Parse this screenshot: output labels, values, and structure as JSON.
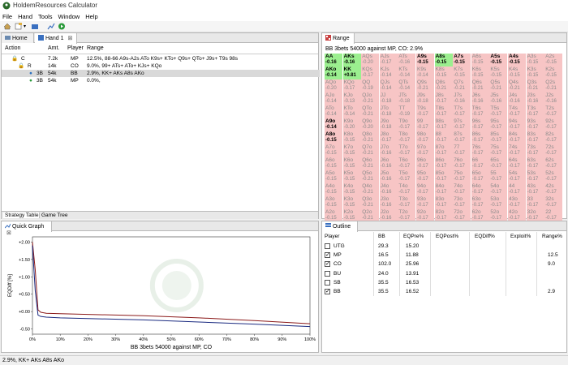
{
  "app": {
    "title": "HoldemResources Calculator"
  },
  "menu": [
    "File",
    "Hand",
    "Tools",
    "Window",
    "Help"
  ],
  "left_tabs": {
    "home": "Home",
    "hand": "Hand 1"
  },
  "table": {
    "headers": [
      "Action",
      "Amt.",
      "Player",
      "Range"
    ],
    "rows": [
      {
        "action": "C",
        "amt": "7.2k",
        "player": "MP",
        "range": "12.5%, 88-66 A9s-A2s ATo K9s+ KTo+ Q9s+ QTo+ J9s+ T9s 98s"
      },
      {
        "action": "R",
        "amt": "14k",
        "player": "CO",
        "range": "9.0%, 99+ ATs+ ATo+ KJs+ KQo"
      },
      {
        "action": "3B",
        "amt": "54k",
        "player": "BB",
        "range": "2.9%, KK+ AKs A8s AKo"
      },
      {
        "action": "3B",
        "amt": "54k",
        "player": "MP",
        "range": "0.0%,"
      }
    ]
  },
  "bottom_tabs": [
    "Strategy Table",
    "Game Tree"
  ],
  "range_panel": {
    "title": "Range",
    "description": "BB 3bets 54000 against MP, CO: 2.9%",
    "cells": [
      [
        "AA",
        "-0.16"
      ],
      [
        "AKs",
        "-0.16"
      ],
      [
        "AQs",
        "-0.20"
      ],
      [
        "AJs",
        "-0.17"
      ],
      [
        "ATs",
        "-0.16"
      ],
      [
        "A9s",
        "-0.15"
      ],
      [
        "A8s",
        "-0.15"
      ],
      [
        "A7s",
        "-0.15"
      ],
      [
        "A6s",
        "-0.15"
      ],
      [
        "A5s",
        "-0.15"
      ],
      [
        "A4s",
        "-0.15"
      ],
      [
        "A3s",
        "-0.15"
      ],
      [
        "A2s",
        "-0.15"
      ],
      [
        "AKo",
        "-0.14"
      ],
      [
        "KK",
        "+0.81"
      ],
      [
        "KQs",
        "-0.17"
      ],
      [
        "KJs",
        "-0.14"
      ],
      [
        "KTs",
        "-0.14"
      ],
      [
        "K9s",
        "-0.14"
      ],
      [
        "K8s",
        "-0.15"
      ],
      [
        "K7s",
        "-0.15"
      ],
      [
        "K6s",
        "-0.15"
      ],
      [
        "K5s",
        "-0.15"
      ],
      [
        "K4s",
        "-0.15"
      ],
      [
        "K3s",
        "-0.15"
      ],
      [
        "K2s",
        "-0.15"
      ],
      [
        "AQo",
        "-0.20"
      ],
      [
        "KQo",
        "-0.17"
      ],
      [
        "QQ",
        "-0.19"
      ],
      [
        "QJs",
        "-0.14"
      ],
      [
        "QTs",
        "-0.14"
      ],
      [
        "Q9s",
        "-0.21"
      ],
      [
        "Q8s",
        "-0.21"
      ],
      [
        "Q7s",
        "-0.21"
      ],
      [
        "Q6s",
        "-0.21"
      ],
      [
        "Q5s",
        "-0.21"
      ],
      [
        "Q4s",
        "-0.21"
      ],
      [
        "Q3s",
        "-0.21"
      ],
      [
        "Q2s",
        "-0.21"
      ],
      [
        "AJo",
        "-0.14"
      ],
      [
        "KJo",
        "-0.13"
      ],
      [
        "QJo",
        "-0.21"
      ],
      [
        "JJ",
        "-0.18"
      ],
      [
        "JTs",
        "-0.18"
      ],
      [
        "J9s",
        "-0.18"
      ],
      [
        "J8s",
        "-0.17"
      ],
      [
        "J7s",
        "-0.16"
      ],
      [
        "J6s",
        "-0.16"
      ],
      [
        "J5s",
        "-0.16"
      ],
      [
        "J4s",
        "-0.16"
      ],
      [
        "J3s",
        "-0.16"
      ],
      [
        "J2s",
        "-0.16"
      ],
      [
        "ATo",
        "-0.14"
      ],
      [
        "KTo",
        "-0.14"
      ],
      [
        "QTo",
        "-0.21"
      ],
      [
        "JTo",
        "-0.18"
      ],
      [
        "TT",
        "-0.19"
      ],
      [
        "T9s",
        "-0.17"
      ],
      [
        "T8s",
        "-0.17"
      ],
      [
        "T7s",
        "-0.17"
      ],
      [
        "T6s",
        "-0.17"
      ],
      [
        "T5s",
        "-0.17"
      ],
      [
        "T4s",
        "-0.17"
      ],
      [
        "T3s",
        "-0.17"
      ],
      [
        "T2s",
        "-0.17"
      ],
      [
        "A9o",
        "-0.14"
      ],
      [
        "K9o",
        "-0.20"
      ],
      [
        "Q9o",
        "-0.20"
      ],
      [
        "J9o",
        "-0.18"
      ],
      [
        "T9o",
        "-0.17"
      ],
      [
        "99",
        "-0.17"
      ],
      [
        "98s",
        "-0.17"
      ],
      [
        "97s",
        "-0.17"
      ],
      [
        "96s",
        "-0.17"
      ],
      [
        "95s",
        "-0.17"
      ],
      [
        "94s",
        "-0.17"
      ],
      [
        "93s",
        "-0.17"
      ],
      [
        "92s",
        "-0.17"
      ],
      [
        "A8o",
        "-0.15"
      ],
      [
        "K8o",
        "-0.15"
      ],
      [
        "Q8o",
        "-0.21"
      ],
      [
        "J8o",
        "-0.17"
      ],
      [
        "T8o",
        "-0.17"
      ],
      [
        "98o",
        "-0.17"
      ],
      [
        "88",
        "-0.17"
      ],
      [
        "87s",
        "-0.17"
      ],
      [
        "86s",
        "-0.17"
      ],
      [
        "85s",
        "-0.17"
      ],
      [
        "84s",
        "-0.17"
      ],
      [
        "83s",
        "-0.17"
      ],
      [
        "82s",
        "-0.17"
      ],
      [
        "A7o",
        "-0.15"
      ],
      [
        "K7o",
        "-0.15"
      ],
      [
        "Q7o",
        "-0.21"
      ],
      [
        "J7o",
        "-0.16"
      ],
      [
        "T7o",
        "-0.17"
      ],
      [
        "97o",
        "-0.17"
      ],
      [
        "87o",
        "-0.17"
      ],
      [
        "77",
        "-0.17"
      ],
      [
        "76s",
        "-0.17"
      ],
      [
        "75s",
        "-0.17"
      ],
      [
        "74s",
        "-0.17"
      ],
      [
        "73s",
        "-0.17"
      ],
      [
        "72s",
        "-0.17"
      ],
      [
        "A6o",
        "-0.15"
      ],
      [
        "K6o",
        "-0.15"
      ],
      [
        "Q6o",
        "-0.21"
      ],
      [
        "J6o",
        "-0.16"
      ],
      [
        "T6o",
        "-0.17"
      ],
      [
        "96o",
        "-0.17"
      ],
      [
        "86o",
        "-0.17"
      ],
      [
        "76o",
        "-0.17"
      ],
      [
        "66",
        "-0.17"
      ],
      [
        "65s",
        "-0.17"
      ],
      [
        "64s",
        "-0.17"
      ],
      [
        "63s",
        "-0.17"
      ],
      [
        "62s",
        "-0.17"
      ],
      [
        "A5o",
        "-0.15"
      ],
      [
        "K5o",
        "-0.15"
      ],
      [
        "Q5o",
        "-0.21"
      ],
      [
        "J5o",
        "-0.16"
      ],
      [
        "T5o",
        "-0.17"
      ],
      [
        "95o",
        "-0.17"
      ],
      [
        "85o",
        "-0.17"
      ],
      [
        "75o",
        "-0.17"
      ],
      [
        "65o",
        "-0.17"
      ],
      [
        "55",
        "-0.17"
      ],
      [
        "54s",
        "-0.17"
      ],
      [
        "53s",
        "-0.17"
      ],
      [
        "52s",
        "-0.17"
      ],
      [
        "A4o",
        "-0.15"
      ],
      [
        "K4o",
        "-0.15"
      ],
      [
        "Q4o",
        "-0.21"
      ],
      [
        "J4o",
        "-0.16"
      ],
      [
        "T4o",
        "-0.17"
      ],
      [
        "94o",
        "-0.17"
      ],
      [
        "84o",
        "-0.17"
      ],
      [
        "74o",
        "-0.17"
      ],
      [
        "64o",
        "-0.17"
      ],
      [
        "54o",
        "-0.17"
      ],
      [
        "44",
        "-0.17"
      ],
      [
        "43s",
        "-0.17"
      ],
      [
        "42s",
        "-0.17"
      ],
      [
        "A3o",
        "-0.15"
      ],
      [
        "K3o",
        "-0.15"
      ],
      [
        "Q3o",
        "-0.21"
      ],
      [
        "J3o",
        "-0.16"
      ],
      [
        "T3o",
        "-0.17"
      ],
      [
        "93o",
        "-0.17"
      ],
      [
        "83o",
        "-0.17"
      ],
      [
        "73o",
        "-0.17"
      ],
      [
        "63o",
        "-0.17"
      ],
      [
        "53o",
        "-0.17"
      ],
      [
        "43o",
        "-0.17"
      ],
      [
        "33",
        "-0.17"
      ],
      [
        "32s",
        "-0.17"
      ],
      [
        "A2o",
        "-0.15"
      ],
      [
        "K2o",
        "-0.15"
      ],
      [
        "Q2o",
        "-0.21"
      ],
      [
        "J2o",
        "-0.16"
      ],
      [
        "T2o",
        "-0.17"
      ],
      [
        "92o",
        "-0.17"
      ],
      [
        "82o",
        "-0.17"
      ],
      [
        "72o",
        "-0.17"
      ],
      [
        "62o",
        "-0.17"
      ],
      [
        "52o",
        "-0.17"
      ],
      [
        "42o",
        "-0.17"
      ],
      [
        "32o",
        "-0.17"
      ],
      [
        "22",
        "-0.17"
      ]
    ],
    "in_range": [
      "AA",
      "AKs",
      "KK",
      "AKo",
      "A8s"
    ],
    "bold": [
      "AA",
      "AKs",
      "A9s",
      "A8s",
      "A7s",
      "A5s",
      "A4s",
      "AKo",
      "KK",
      "A9o",
      "A8o"
    ]
  },
  "quick_graph": {
    "title": "Quick Graph",
    "xlabel": "BB 3bets 54000 against MP, CO",
    "ylabel": "EQDiff [%]"
  },
  "chart_data": {
    "type": "line",
    "title": "",
    "xlabel": "BB 3bets 54000 against MP, CO",
    "ylabel": "EQDiff [%]",
    "x_ticks": [
      "0%",
      "10%",
      "20%",
      "30%",
      "40%",
      "50%",
      "60%",
      "70%",
      "80%",
      "90%",
      "100%"
    ],
    "y_ticks": [
      "+2.00",
      "+1.50",
      "+1.00",
      "+0.50",
      "+0.00",
      "-0.50"
    ],
    "ylim": [
      -0.65,
      2.15
    ],
    "series": [
      {
        "color": "#8b1a1a",
        "x": [
          0,
          1,
          2,
          3,
          5,
          10,
          20,
          40,
          60,
          80,
          100
        ],
        "y": [
          2.0,
          1.2,
          0.05,
          -0.02,
          -0.05,
          -0.06,
          -0.08,
          -0.12,
          -0.18,
          -0.26,
          -0.35
        ]
      },
      {
        "color": "#1a2a80",
        "x": [
          0,
          1,
          2,
          3,
          5,
          10,
          20,
          40,
          60,
          80,
          100
        ],
        "y": [
          1.9,
          0.6,
          -0.1,
          -0.14,
          -0.16,
          -0.18,
          -0.2,
          -0.24,
          -0.3,
          -0.36,
          -0.43
        ]
      }
    ]
  },
  "outline": {
    "title": "Outline",
    "headers": [
      "Player",
      "BB",
      "EQPre%",
      "EQPost%",
      "EQDiff%",
      "Exploit%",
      "Range%"
    ],
    "rows": [
      {
        "checked": false,
        "player": "UTG",
        "bb": "29.3",
        "eqpre": "15.20",
        "range": ""
      },
      {
        "checked": true,
        "player": "MP",
        "bb": "16.5",
        "eqpre": "11.88",
        "range": "12.5"
      },
      {
        "checked": true,
        "player": "CO",
        "bb": "102.0",
        "eqpre": "25.96",
        "range": "9.0"
      },
      {
        "checked": false,
        "player": "BU",
        "bb": "24.0",
        "eqpre": "13.91",
        "range": ""
      },
      {
        "checked": false,
        "player": "SB",
        "bb": "35.5",
        "eqpre": "16.53",
        "range": ""
      },
      {
        "checked": true,
        "player": "BB",
        "bb": "35.5",
        "eqpre": "16.52",
        "range": "2.9"
      }
    ]
  },
  "status": "2.9%, KK+ AKs A8s AKo"
}
